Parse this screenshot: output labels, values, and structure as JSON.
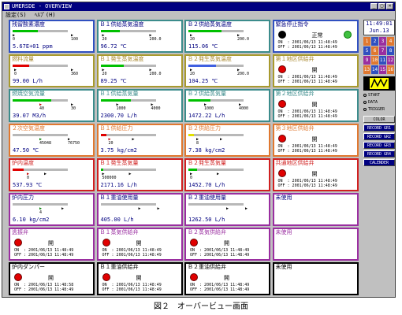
{
  "window": {
    "title": "UMERSDE - OVERVIEW",
    "menu": [
      "設定(S)",
      "ﾍﾙﾌﾟ(H)"
    ]
  },
  "colors": {
    "gray": "#6b6b6b",
    "yellow": "#a89a2e",
    "green": "#3c8c8c",
    "blue": "#3050c0",
    "orange": "#e07830",
    "red": "#d02020",
    "purple": "#9a2ea0",
    "black": "#000000"
  },
  "panels": [
    {
      "title": "残留酸素濃度",
      "border": "blue",
      "titlecolor": "#000080",
      "ticks": [
        {
          "v": "0",
          "p": 0,
          "c": "k"
        },
        {
          "v": "100",
          "p": 74,
          "c": "k"
        }
      ],
      "fill": 0.45,
      "fillcolor": "#00c000",
      "value": "5.67E+01 ppm"
    },
    {
      "title": "Ｂ１供給蒸気温度",
      "border": "green",
      "titlecolor": "#000080",
      "ticks": [
        {
          "v": "20",
          "p": 2,
          "c": "k"
        },
        {
          "v": "200.0",
          "p": 62,
          "c": "k"
        }
      ],
      "fill": 0.35,
      "fillcolor": "#00c000",
      "value": "96.72 ℃"
    },
    {
      "title": "Ｂ２供給蒸気温度",
      "border": "green",
      "titlecolor": "#000080",
      "ticks": [
        {
          "v": "20",
          "p": 2,
          "c": "k"
        },
        {
          "v": "200.0",
          "p": 62,
          "c": "k"
        }
      ],
      "fill": 0.6,
      "fillcolor": "#00c000",
      "value": "115.06 ℃"
    },
    {
      "title": "緊急停止指令",
      "border": "blue",
      "titlecolor": "#000080",
      "lamp": "black",
      "lamp2": "green",
      "state": "正常",
      "off": "2001/06/13 11:48:49",
      "on": "2001/06/13 11:48:49"
    },
    {
      "title": "燃料流量",
      "border": "yellow",
      "titlecolor": "#a8882e",
      "ticks": [
        {
          "v": "0",
          "p": 2,
          "c": "k"
        },
        {
          "v": "360",
          "p": 74,
          "c": "k"
        }
      ],
      "fill": 0.3,
      "fillcolor": "#e00000",
      "value": "99.00 L/h"
    },
    {
      "title": "Ｂ１発生蒸気温度",
      "border": "yellow",
      "titlecolor": "#a8882e",
      "ticks": [
        {
          "v": "20",
          "p": 2,
          "c": "k"
        },
        {
          "v": "200.0",
          "p": 62,
          "c": "k"
        }
      ],
      "fill": 0.42,
      "fillcolor": "#00c000",
      "value": "89.25 ℃"
    },
    {
      "title": "Ｂ２発生蒸気温度",
      "border": "yellow",
      "titlecolor": "#a8882e",
      "ticks": [
        {
          "v": "20",
          "p": 2,
          "c": "k"
        },
        {
          "v": "200.0",
          "p": 62,
          "c": "k"
        }
      ],
      "fill": 0.5,
      "fillcolor": "#4060e0",
      "value": "104.25 ℃"
    },
    {
      "title": "第１地区供給弁",
      "border": "yellow",
      "titlecolor": "#a8882e",
      "lamp": "red",
      "state": "開",
      "off": "2001/06/13 11:48:49",
      "on": "2001/06/13 11:48:49"
    },
    {
      "title": "燃焼空気流量",
      "border": "green",
      "titlecolor": "#3c8c8c",
      "ticks": [
        {
          "v": "40",
          "p": 34,
          "c": "r"
        },
        {
          "v": "30",
          "p": 74,
          "c": "k"
        }
      ],
      "fill": 0.7,
      "fillcolor": "#00c000",
      "value": "39.07 M3/h"
    },
    {
      "title": "Ｂ１供給蒸気量",
      "border": "green",
      "titlecolor": "#3c8c8c",
      "ticks": [
        {
          "v": "1000",
          "p": 20,
          "c": "k"
        },
        {
          "v": "4000",
          "p": 64,
          "c": "k"
        }
      ],
      "fill": 0.55,
      "fillcolor": "#00c000",
      "value": "2300.70 L/h"
    },
    {
      "title": "Ｂ２供給蒸気量",
      "border": "green",
      "titlecolor": "#3c8c8c",
      "ticks": [
        {
          "v": "1000",
          "p": 20,
          "c": "k"
        },
        {
          "v": "4000",
          "p": 64,
          "c": "k"
        }
      ],
      "fill": 0.4,
      "fillcolor": "#00c000",
      "value": "1472.22 L/h"
    },
    {
      "title": "第２地区供給弁",
      "border": "green",
      "titlecolor": "#3c8c8c",
      "lamp": "red",
      "state": "開",
      "off": "2001/06/13 11:48:49",
      "on": "2001/06/13 11:48:49"
    },
    {
      "title": "２次空気温度",
      "border": "orange",
      "titlecolor": "#e07830",
      "ticks": [
        {
          "v": "45048",
          "p": 34,
          "c": "g"
        },
        {
          "v": "76750",
          "p": 70,
          "c": "k"
        }
      ],
      "fill": 0.0,
      "fillcolor": "#00c000",
      "value": "47.50 ℃"
    },
    {
      "title": "Ｂ１供給圧力",
      "border": "orange",
      "titlecolor": "#e07830",
      "ticks": [
        {
          "v": "20",
          "p": 10,
          "c": "r"
        },
        {
          "v": "",
          "p": 40,
          "c": "k"
        }
      ],
      "fill": 0.1,
      "fillcolor": "#e00000",
      "value": "3.75 kg/cm2"
    },
    {
      "title": "Ｂ２供給圧力",
      "border": "orange",
      "titlecolor": "#e07830",
      "ticks": [
        {
          "v": "8",
          "p": 10,
          "c": "k"
        },
        {
          "v": "",
          "p": 40,
          "c": "k"
        }
      ],
      "fill": 0.1,
      "fillcolor": "#e0e000",
      "value": "7.38 kg/cm2"
    },
    {
      "title": "第３地区供給弁",
      "border": "orange",
      "titlecolor": "#e07830",
      "lamp": "red",
      "state": "開",
      "off": "2001/06/13 11:48:49",
      "on": "2001/06/13 11:48:49"
    },
    {
      "title": "炉内温度",
      "border": "red",
      "titlecolor": "#d02020",
      "ticks": [
        {
          "v": "0",
          "p": 18,
          "c": "r"
        },
        {
          "v": "",
          "p": 40,
          "c": "k"
        }
      ],
      "fill": 0.2,
      "fillcolor": "#e00000",
      "value": "537.93 ℃"
    },
    {
      "title": "Ｂ１発生蒸気量",
      "border": "red",
      "titlecolor": "#d02020",
      "ticks": [
        {
          "v": "500000",
          "p": 2,
          "c": "k"
        },
        {
          "v": "",
          "p": 36,
          "c": "k"
        }
      ],
      "fill": 0.05,
      "fillcolor": "#00c000",
      "value": "2171.16 L/h"
    },
    {
      "title": "Ｂ２発生蒸気量",
      "border": "red",
      "titlecolor": "#d02020",
      "ticks": [
        {
          "v": "0",
          "p": 2,
          "c": "k"
        },
        {
          "v": "",
          "p": 36,
          "c": "k"
        }
      ],
      "fill": 0.15,
      "fillcolor": "#00c000",
      "value": "1452.70 L/h"
    },
    {
      "title": "共通地区供給弁",
      "border": "red",
      "titlecolor": "#d02020",
      "lamp": "red",
      "state": "開",
      "off": "2001/06/13 11:48:49",
      "on": "2001/06/13 11:48:49"
    },
    {
      "title": "炉内圧力",
      "border": "purple",
      "titlecolor": "#000080",
      "ticks": [
        {
          "v": "4",
          "p": 34,
          "c": "g"
        },
        {
          "v": "",
          "p": 62,
          "c": "k"
        }
      ],
      "fill": 0.0,
      "fillcolor": "#00c000",
      "value": "6.10 kg/cm2"
    },
    {
      "title": "Ｂ１重油使用量",
      "border": "purple",
      "titlecolor": "#000080",
      "ticks": [
        {
          "v": "",
          "p": 48,
          "c": "k"
        },
        {
          "v": "",
          "p": 72,
          "c": "k"
        }
      ],
      "fill": 0.0,
      "fillcolor": "#00c000",
      "value": "405.00 L/h"
    },
    {
      "title": "Ｂ２重油使用量",
      "border": "purple",
      "titlecolor": "#000080",
      "ticks": [
        {
          "v": "",
          "p": 48,
          "c": "k"
        },
        {
          "v": "",
          "p": 72,
          "c": "k"
        }
      ],
      "fill": 0.0,
      "fillcolor": "#00c000",
      "value": "1262.50 L/h"
    },
    {
      "title": "未使用",
      "border": "purple",
      "titlecolor": "#000080",
      "empty": true
    },
    {
      "title": "逃振弁",
      "border": "purple",
      "titlecolor": "#9a2ea0",
      "lamp": "red",
      "state": "開",
      "off": "2001/06/13 11:48:49",
      "on": "2001/06/13 11:48:49"
    },
    {
      "title": "Ｂ１蒸気供給弁",
      "border": "purple",
      "titlecolor": "#9a2ea0",
      "lamp": "red",
      "state": "開",
      "off": "2001/06/13 11:48:49",
      "on": "2001/06/13 11:48:49"
    },
    {
      "title": "Ｂ２蒸気供給弁",
      "border": "purple",
      "titlecolor": "#9a2ea0",
      "lamp": "red",
      "state": "開",
      "off": "2001/06/13 11:48:49",
      "on": "2001/06/13 11:48:49"
    },
    {
      "title": "未使用",
      "border": "purple",
      "titlecolor": "#9a2ea0",
      "empty": true
    },
    {
      "title": "炉内ダンパー",
      "border": "black",
      "titlecolor": "#000000",
      "lamp": "red",
      "state": "開",
      "off": "2001/06/13 11:48:49",
      "on": "2001/06/13 11:48:58"
    },
    {
      "title": "Ｂ１重油供給弁",
      "border": "black",
      "titlecolor": "#000000",
      "lamp": "red",
      "state": "開",
      "off": "2001/06/13 11:48:49",
      "on": "2001/06/13 11:48:49"
    },
    {
      "title": "Ｂ２重油供給弁",
      "border": "black",
      "titlecolor": "#000000",
      "lamp": "red",
      "state": "開",
      "off": "2001/06/13 11:48:49",
      "on": "2001/06/13 11:48:49"
    },
    {
      "title": "未使用",
      "border": "black",
      "titlecolor": "#000000",
      "empty": true
    }
  ],
  "side": {
    "time": "11:49:01",
    "date": "Jun.13",
    "lights": [
      {
        "t": "1",
        "c": "#e07830"
      },
      {
        "t": "2",
        "c": "#3050c0"
      },
      {
        "t": "3",
        "c": "#9a2ea0"
      },
      {
        "t": "4",
        "c": "#e07830"
      },
      {
        "t": "5",
        "c": "#3050c0"
      },
      {
        "t": "6",
        "c": "#e07830"
      },
      {
        "t": "7",
        "c": "#9a2ea0"
      },
      {
        "t": "8",
        "c": "#3050c0"
      },
      {
        "t": "9",
        "c": "#9a2ea0"
      },
      {
        "t": "10",
        "c": "#e07830"
      },
      {
        "t": "11",
        "c": "#3050c0"
      },
      {
        "t": "12",
        "c": "#9a2ea0"
      },
      {
        "t": "13",
        "c": "#e07830"
      },
      {
        "t": "14",
        "c": "#3050c0"
      },
      {
        "t": "15",
        "c": "#9a2ea0"
      },
      {
        "t": "16",
        "c": "#e07830"
      }
    ],
    "radio": [
      "START",
      "DATA",
      "TRIGGER"
    ],
    "buttons": [
      "COLOR",
      "RECORD GR1",
      "RECORD GR2",
      "RECORD GR3",
      "RECORD GR4",
      "CALENDER"
    ]
  },
  "caption": "図２　オーバービュー画面"
}
